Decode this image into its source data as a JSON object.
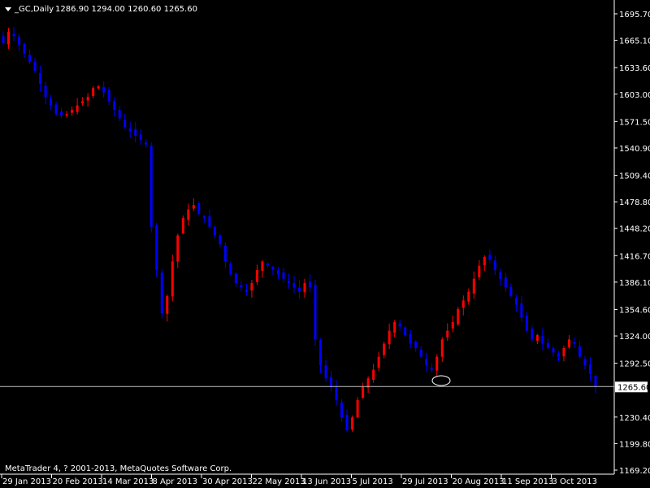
{
  "window": {
    "symbol_header": "_GC,Daily",
    "ohlc_header": "1286.90 1294.00 1260.60 1265.60",
    "copyright": "MetaTrader 4, ? 2001-2013, MetaQuotes Software Corp.",
    "current_price_label": "1265.60"
  },
  "colors": {
    "background": "#000000",
    "bull": "#ff0000",
    "bear": "#0000ff",
    "axis": "#ffffff",
    "price_line": "#c0c0c0",
    "marker": "#ffffff"
  },
  "chart_data": {
    "type": "candlestick",
    "title": "_GC,Daily",
    "ylim": [
      1169.2,
      1695.7
    ],
    "y_ticks": [
      "1695.70",
      "1665.10",
      "1633.60",
      "1603.00",
      "1571.50",
      "1540.90",
      "1509.40",
      "1478.80",
      "1448.20",
      "1416.70",
      "1386.10",
      "1354.60",
      "1324.00",
      "1292.50",
      "1265.60",
      "1230.40",
      "1199.80",
      "1169.20"
    ],
    "x_ticks": [
      "29 Jan 2013",
      "20 Feb 2013",
      "14 Mar 2013",
      "8 Apr 2013",
      "30 Apr 2013",
      "22 May 2013",
      "13 Jun 2013",
      "5 Jul 2013",
      "29 Jul 2013",
      "20 Aug 2013",
      "11 Sep 2013",
      "3 Oct 2013"
    ],
    "last_close": 1265.6,
    "grid": false,
    "annotations": [
      {
        "type": "ellipse-marker",
        "near": "29 Jul 2013",
        "value": 1280
      }
    ],
    "close_path": [
      1662,
      1675,
      1670,
      1660,
      1650,
      1640,
      1630,
      1615,
      1600,
      1590,
      1580,
      1578,
      1580,
      1585,
      1590,
      1595,
      1600,
      1610,
      1612,
      1605,
      1595,
      1585,
      1575,
      1565,
      1560,
      1555,
      1550,
      1545,
      1450,
      1400,
      1350,
      1370,
      1410,
      1440,
      1460,
      1470,
      1475,
      1465,
      1460,
      1450,
      1440,
      1430,
      1410,
      1395,
      1385,
      1380,
      1375,
      1385,
      1400,
      1410,
      1405,
      1400,
      1395,
      1390,
      1385,
      1380,
      1375,
      1385,
      1380,
      1320,
      1290,
      1275,
      1265,
      1250,
      1230,
      1215,
      1230,
      1250,
      1265,
      1275,
      1285,
      1300,
      1315,
      1330,
      1340,
      1335,
      1325,
      1315,
      1310,
      1300,
      1290,
      1285,
      1300,
      1320,
      1330,
      1340,
      1355,
      1365,
      1375,
      1390,
      1405,
      1415,
      1412,
      1400,
      1390,
      1380,
      1370,
      1360,
      1345,
      1330,
      1320,
      1325,
      1315,
      1310,
      1305,
      1300,
      1310,
      1320,
      1315,
      1300,
      1290,
      1280,
      1265.6
    ]
  }
}
